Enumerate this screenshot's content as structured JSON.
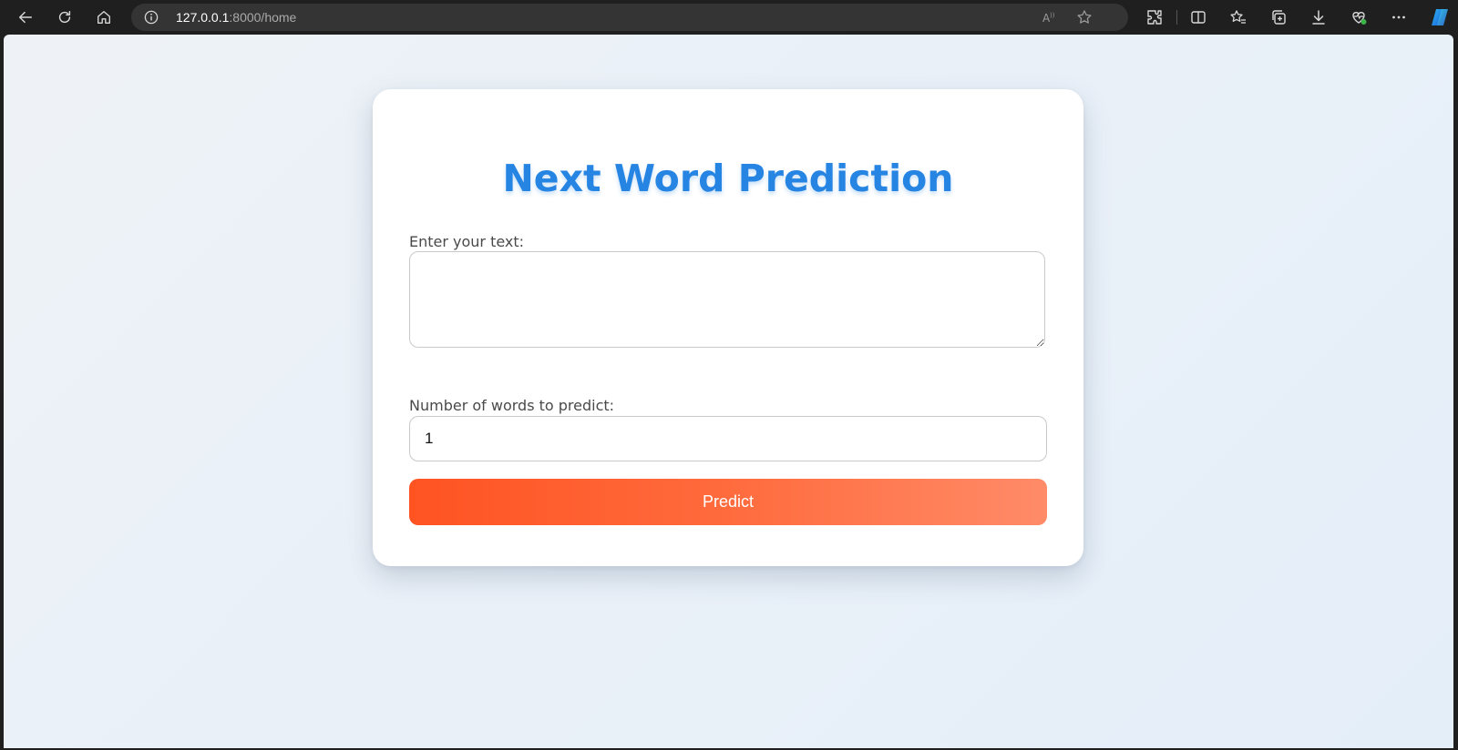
{
  "browser": {
    "url_host": "127.0.0.1",
    "url_rest": ":8000/home",
    "icons": [
      "back-icon",
      "refresh-icon",
      "home-icon",
      "site-info-icon",
      "read-aloud-icon",
      "favorite-star-icon",
      "extensions-icon",
      "split-screen-icon",
      "favorites-icon",
      "collections-icon",
      "downloads-icon",
      "browser-essentials-icon",
      "more-icon",
      "copilot-icon"
    ]
  },
  "page": {
    "title": "Next Word Prediction",
    "text_label": "Enter your text:",
    "text_value": "",
    "count_label": "Number of words to predict:",
    "count_value": "1",
    "predict_label": "Predict"
  },
  "colors": {
    "title": "#2684e3",
    "button_start": "#ff5322",
    "button_end": "#ff8b68"
  }
}
